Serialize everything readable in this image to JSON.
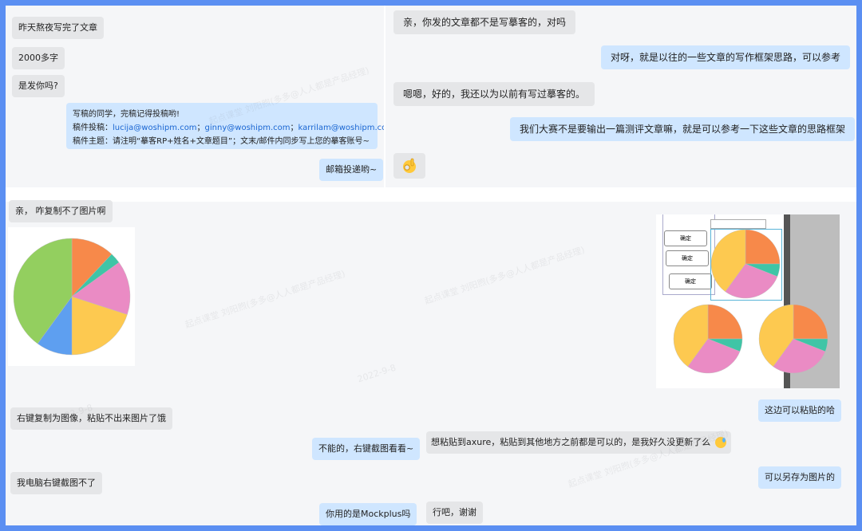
{
  "top_left_chat": {
    "messages": [
      {
        "side": "left",
        "text": "昨天熬夜写完了文章"
      },
      {
        "side": "left",
        "text": "2000多字"
      },
      {
        "side": "left",
        "text": "是发你吗?"
      }
    ],
    "email_card": {
      "line1": "写稿的同学，完稿记得投稿哟!",
      "submit_label": "稿件投稿：",
      "email1": "lucija@woshipm.com",
      "sep1": "；",
      "email2": "ginny@woshipm.com",
      "sep2": "；",
      "email3": "karrilam@woshipm.com",
      "line3": "稿件主题：请注明“摹客RP+姓名+文章题目”；文末/邮件内同步写上您的摹客账号~"
    },
    "mail_button": "邮箱投递哟~"
  },
  "top_right_chat": {
    "messages": [
      {
        "side": "left",
        "text": "亲，你发的文章都不是写摹客的，对吗"
      },
      {
        "side": "right",
        "text": "对呀，就是以往的一些文章的写作框架思路，可以参考"
      },
      {
        "side": "left",
        "text": "嗯嗯，好的，我还以为以前有写过摹客的。"
      },
      {
        "side": "right",
        "text": "我们大赛不是要输出一篇测评文章嘛，就是可以参考一下这些文章的思路框架"
      }
    ],
    "emoji_name": "ok-hand-emoji"
  },
  "bottom_chat": {
    "msg_image_fail": "亲， 咋复制不了图片啊",
    "msg_right_click": "右键复制为图像，粘贴不出来图片了饿",
    "msg_no_screenshot": "我电脑右键截图不了",
    "msg_cant_screenshot": "不能的，右键截图看看~",
    "msg_mockplus": "你用的是Mockplus吗",
    "msg_axure": "想粘贴到axure，粘贴到其他地方之前都是可以的，是我好久没更新了么",
    "msg_ok_thanks": "行吧，谢谢",
    "msg_can_paste": "这边可以粘贴的哈",
    "msg_save_image": "可以另存为图片的",
    "confirm_btn": "确定"
  },
  "pie_colors": {
    "orange": "#f7894a",
    "teal": "#3fc5a6",
    "pink": "#ea8bc4",
    "yellow": "#fdc950",
    "blue": "#5e9ff0",
    "green": "#93cf5f"
  },
  "watermark_text": "起点课堂 刘阳煦(多多@人人都是产品经理)",
  "watermark_date": "2022-9-8"
}
